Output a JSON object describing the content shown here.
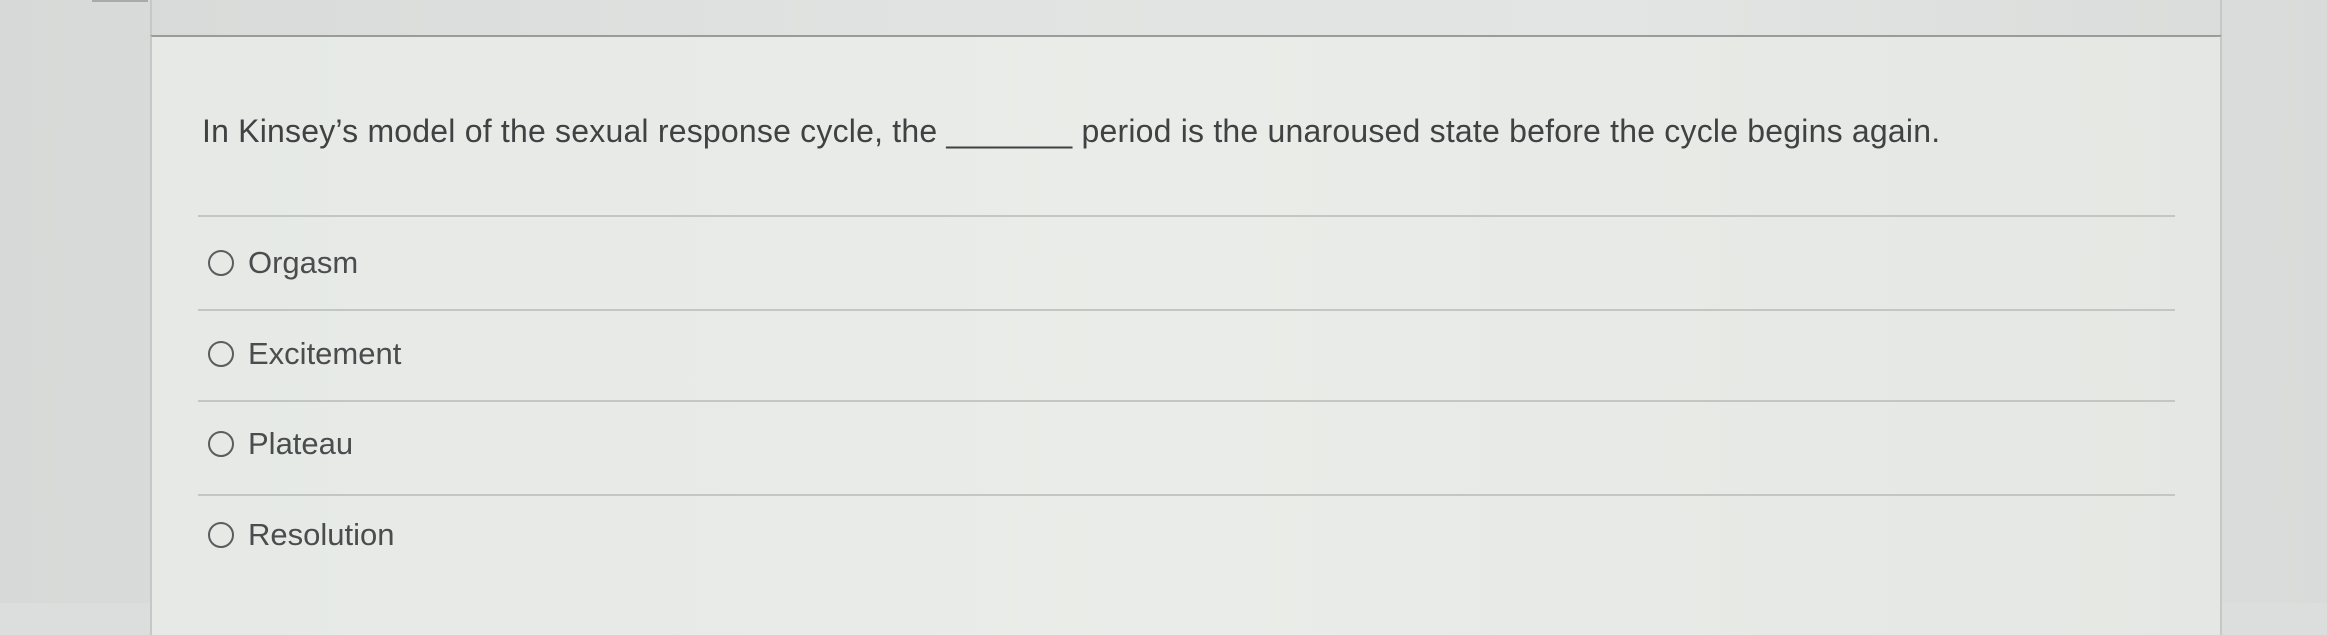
{
  "question": {
    "text": "In Kinsey’s model of the sexual response cycle, the _______ period is the unaroused state before the cycle begins again."
  },
  "options": [
    {
      "label": "Orgasm",
      "selected": false
    },
    {
      "label": "Excitement",
      "selected": false
    },
    {
      "label": "Plateau",
      "selected": false
    },
    {
      "label": "Resolution",
      "selected": false
    }
  ]
}
